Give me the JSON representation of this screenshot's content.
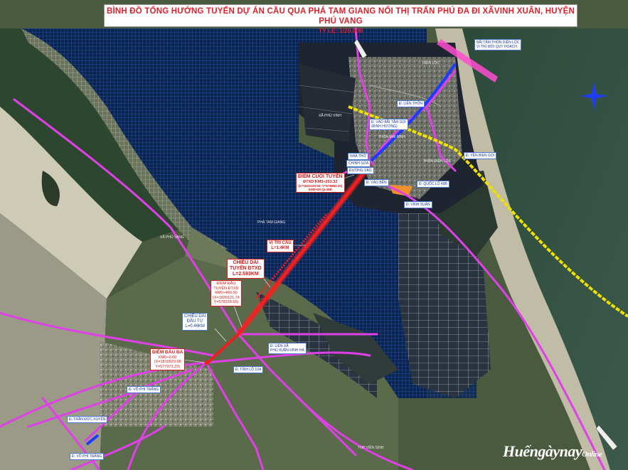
{
  "title": {
    "line1": "BÌNH ĐỒ TỔNG HƯỚNG TUYẾN DỰ ÁN CẦU QUA PHÁ TAM GIANG NỐI THỊ TRẤN PHÚ ĐA ĐI XÃVINH XUÂN, HUYỆN PHÚ VANG",
    "line2": "TỶ LỆ: 1/20.000"
  },
  "labels": {
    "diem_cuoi_1": "ĐIỂM CUỐI TUYẾN",
    "diem_cuoi_2": "ĐTXD KM3+253.32",
    "diem_cuoi_3": "(X=1822100.50; Y=578884.30)",
    "diem_cuoi_4": "KM0+00 QL49B",
    "vi_tri_cau_1": "VỊ TRÍ CẦU",
    "vi_tri_cau_2": "L=1.4KM",
    "chieu_dai_1": "CHIỀU DÀI",
    "chieu_dai_2": "TUYẾN ĐTXD",
    "chieu_dai_3": "L=2.593KM",
    "diem_dau_tuyen_1": "ĐIỂM ĐẦU",
    "diem_dau_tuyen_2": "TUYẾN ĐTXD",
    "diem_dau_tuyen_3": "KM0+460.00",
    "diem_dau_tuyen_4": "(X=1820121.74",
    "diem_dau_tuyen_5": "Y=578228.66)",
    "chieu_dai_dau_tu_1": "CHIỀU DÀI",
    "chieu_dai_dau_tu_2": "ĐẦU TƯ",
    "chieu_dai_dau_tu_3": "L=0.46KM",
    "diem_dau_da_1": "ĐIỂM ĐẦU ĐA",
    "diem_dau_da_2": "KM0+0.00",
    "diem_dau_da_3": "(X=1819829.98",
    "diem_dau_da_4": "Y=577973.23)",
    "road_vao_bai_tam": "Đ. VÀO BÃI TẮM GỌI",
    "road_vao_bai_tam_2": "(ĐINH HƯƠNG)",
    "road_lien_thon": "Đ. LIÊN THÔN",
    "road_yen_bien": "Đ. YÊN BIỂN GỌI",
    "road_ql49b": "Đ. QUỐC LỘ 49B",
    "road_vinh_xuan": "Đ. VINH XUÂN",
    "road_lien_xa_1": "Đ. LIÊN XÃ",
    "road_lien_xa_2": "PHÚ XUÂN-VINH HÀ",
    "road_tinh_lo": "Đ. TỈNH LỘ 10A",
    "road_vo_phi_trang": "Đ. VÕ PHI TRẮNG",
    "road_tran_duc_xuyen": "Đ. TRẦN ĐỨC XUYÊN",
    "road_vo_phi_trang_2": "Đ. VÕ PHI TRẮNG",
    "road_viem_sinh": "TOP VIÊN SINH",
    "road_nha_tho": "NHÀ THỜ",
    "road_chinh_sua": "CHÍNH SỬA",
    "road_duong_vao": "ĐƯỜNG VÀO",
    "road_vao_ben": "Đ. VÀO BẾN",
    "bai_tam_1": "BÃI TẮM THÔN DIÊN LỘC",
    "bai_tam_2": "VỊ TRÍ MỚI QUY HOẠCH",
    "area_xa_phu_vinh": "XÃ PHÚ VINH",
    "area_thon_mai_binh": "THÔN MAI BÌNH",
    "area_pha_tam_giang": "PHÁ TAM GIANG",
    "area_xa_phu_vang": "XÃ PHÚ VANG",
    "area_dien_loc": "DIÊN LỘC",
    "area_thon_dien": "THÔN DIÊN LỘC",
    "logo_main": "Huếngàynay",
    "logo_sub": "Online"
  },
  "colors": {
    "route_red": "#e82020",
    "road_magenta": "#e040e8",
    "road_blue": "#1e3cff",
    "road_yellow": "#f0e000",
    "water": "#0e2a55",
    "grid": "#2d56a8",
    "land": "#3a5a32",
    "sand": "#b8b6a6"
  },
  "icons": [
    "compass-icon"
  ]
}
